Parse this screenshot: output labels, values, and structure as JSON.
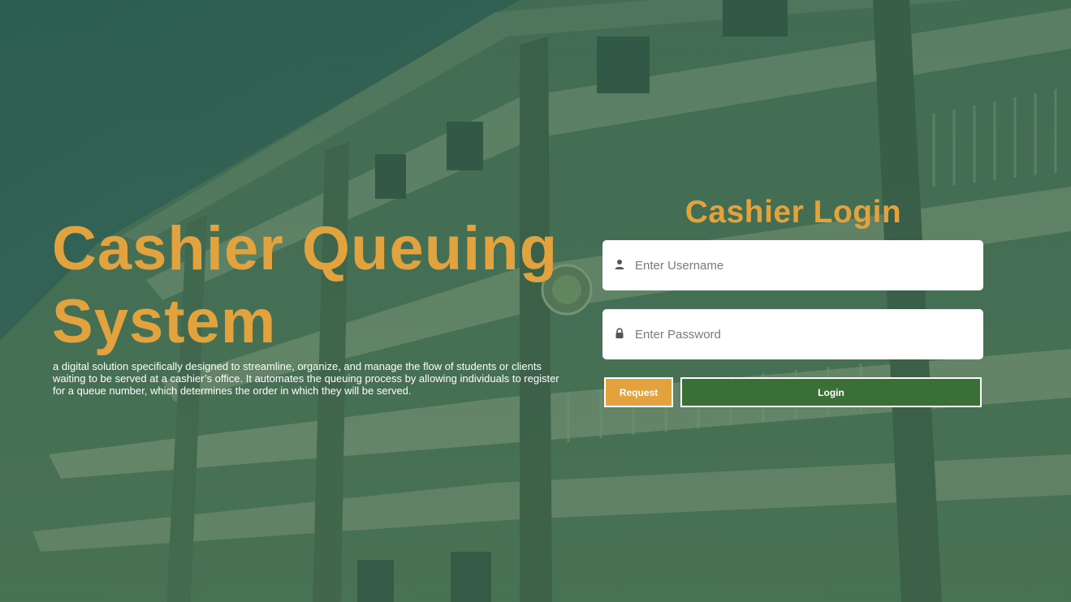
{
  "hero": {
    "title": "Cashier Queuing System",
    "description": "a digital solution specifically designed to streamline, organize, and manage the flow of students or clients waiting to be served at a cashier’s office. It automates the queuing process by allowing individuals to register for a queue number, which determines the order in which they will be served."
  },
  "login": {
    "title": "Cashier Login",
    "username_placeholder": "Enter Username",
    "password_placeholder": "Enter Password",
    "username_value": "",
    "password_value": "",
    "request_label": "Request",
    "login_label": "Login"
  },
  "icons": {
    "username": "user-icon",
    "password": "lock-icon"
  },
  "colors": {
    "accent_orange": "#e2a23e",
    "login_green": "#3a6f35",
    "background_green": "#3f6a55",
    "text_white": "#ffffff"
  }
}
